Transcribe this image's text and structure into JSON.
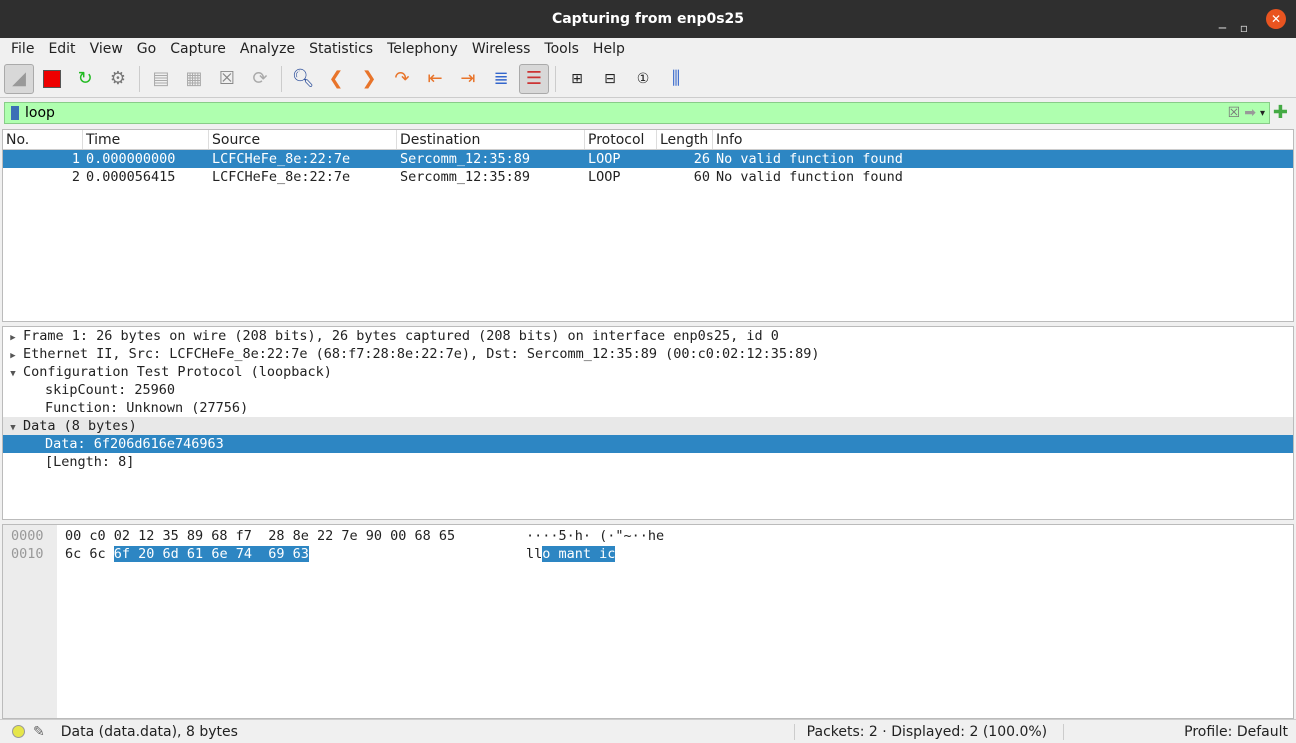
{
  "window": {
    "title": "Capturing from enp0s25"
  },
  "menu": [
    "File",
    "Edit",
    "View",
    "Go",
    "Capture",
    "Analyze",
    "Statistics",
    "Telephony",
    "Wireless",
    "Tools",
    "Help"
  ],
  "filter": {
    "value": "loop"
  },
  "columns": [
    "No.",
    "Time",
    "Source",
    "Destination",
    "Protocol",
    "Length",
    "Info"
  ],
  "packets": [
    [
      "1",
      "0.000000000",
      "LCFCHeFe_8e:22:7e",
      "Sercomm_12:35:89",
      "LOOP",
      "26",
      "No valid function found"
    ],
    [
      "2",
      "0.000056415",
      "LCFCHeFe_8e:22:7e",
      "Sercomm_12:35:89",
      "LOOP",
      "60",
      "No valid function found"
    ]
  ],
  "details": [
    "Frame 1: 26 bytes on wire (208 bits), 26 bytes captured (208 bits) on interface enp0s25, id 0",
    "Ethernet II, Src: LCFCHeFe_8e:22:7e (68:f7:28:8e:22:7e), Dst: Sercomm_12:35:89 (00:c0:02:12:35:89)",
    "Configuration Test Protocol (loopback)",
    "skipCount: 25960",
    "Function: Unknown (27756)",
    "Data (8 bytes)",
    "Data: 6f206d616e746963",
    "[Length: 8]"
  ],
  "bytes": {
    "offsets": [
      "0000",
      "0010"
    ],
    "row0_hex": "00 c0 02 12 35 89 68 f7  28 8e 22 7e 90 00 68 65",
    "row0_ascii": "····5·h· (·\"~··he",
    "row1_hex_plain": "6c 6c ",
    "row1_hex_sel": "6f 20 6d 61 6e 74  69 63",
    "row1_ascii_plain": "ll",
    "row1_ascii_sel": "o mant ic"
  },
  "status": {
    "field": "Data (data.data), 8 bytes",
    "packets": "Packets: 2 · Displayed: 2 (100.0%)",
    "profile": "Profile: Default"
  }
}
